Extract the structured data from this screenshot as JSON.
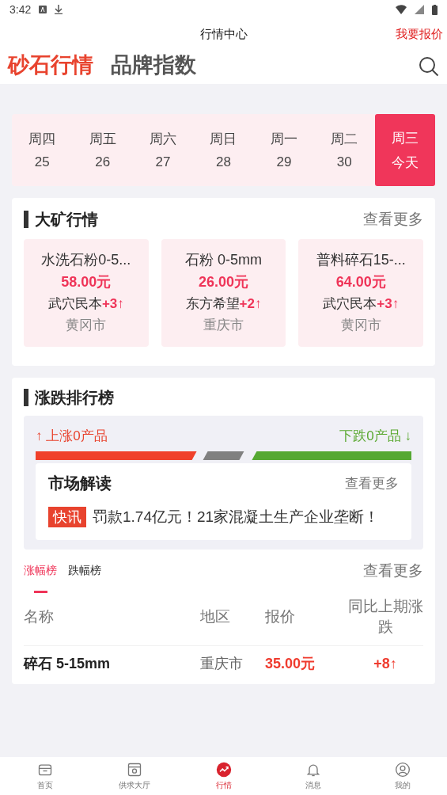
{
  "status_bar": {
    "time": "3:42"
  },
  "header": {
    "title": "行情中心",
    "action": "我要报价"
  },
  "tabs": [
    {
      "label": "砂石行情",
      "selected": true
    },
    {
      "label": "品牌指数",
      "selected": false
    }
  ],
  "days": [
    {
      "weekday": "周四",
      "date": "25",
      "selected": false
    },
    {
      "weekday": "周五",
      "date": "26",
      "selected": false
    },
    {
      "weekday": "周六",
      "date": "27",
      "selected": false
    },
    {
      "weekday": "周日",
      "date": "28",
      "selected": false
    },
    {
      "weekday": "周一",
      "date": "29",
      "selected": false
    },
    {
      "weekday": "周二",
      "date": "30",
      "selected": false
    },
    {
      "weekday": "周三",
      "date": "今天",
      "selected": true
    }
  ],
  "mine_section": {
    "title": "大矿行情",
    "more": "查看更多",
    "items": [
      {
        "name": "水洗石粉0-5...",
        "price": "58.00元",
        "company": "武穴民本",
        "change": "+3",
        "arrow": "↑",
        "city": "黄冈市"
      },
      {
        "name": "石粉 0-5mm",
        "price": "26.00元",
        "company": "东方希望",
        "change": "+2",
        "arrow": "↑",
        "city": "重庆市"
      },
      {
        "name": "普料碎石15-...",
        "price": "64.00元",
        "company": "武穴民本",
        "change": "+3",
        "arrow": "↑",
        "city": "黄冈市"
      }
    ]
  },
  "ranking_section": {
    "title": "涨跌排行榜",
    "rise_arrow": "↑",
    "rise": "上涨0产品",
    "fall": "下跌0产品",
    "fall_arrow": "↓",
    "market": {
      "title": "市场解读",
      "more": "查看更多",
      "tag": "快讯",
      "headline": "罚款1.74亿元！21家混凝土生产企业垄断！"
    },
    "rank_tabs": [
      {
        "label": "涨幅榜",
        "selected": true
      },
      {
        "label": "跌幅榜",
        "selected": false
      }
    ],
    "more": "查看更多",
    "table": {
      "columns": [
        "名称",
        "地区",
        "报价",
        "同比上期涨跌"
      ],
      "rows": [
        {
          "name": "碎石 5-15mm",
          "region": "重庆市",
          "price": "35.00元",
          "change": "+8↑"
        }
      ]
    }
  },
  "bottom_nav": [
    {
      "label": "首页",
      "selected": false
    },
    {
      "label": "供求大厅",
      "selected": false
    },
    {
      "label": "行情",
      "selected": true
    },
    {
      "label": "消息",
      "selected": false
    },
    {
      "label": "我的",
      "selected": false
    }
  ]
}
